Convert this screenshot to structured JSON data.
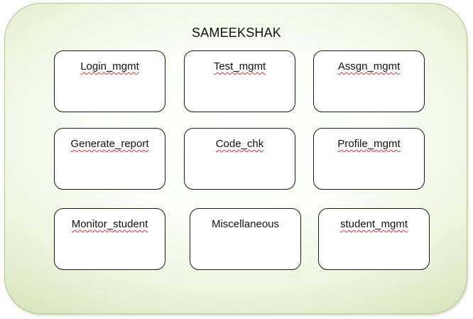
{
  "diagram": {
    "title": "SAMEEKSHAK",
    "modules": [
      {
        "label": "Login_mgmt"
      },
      {
        "label": "Test_mgmt"
      },
      {
        "label": "Assgn_mgmt"
      },
      {
        "label": "Generate_report"
      },
      {
        "label": "Code_chk"
      },
      {
        "label": "Profile_mgmt"
      },
      {
        "label": "Monitor_student"
      },
      {
        "label": "Miscellaneous"
      },
      {
        "label": "student_mgmt"
      }
    ]
  },
  "colors": {
    "container_border": "#b4c98e",
    "container_fill_edge": "#d9e6bf",
    "box_border": "#1a1a1a",
    "spellcheck_underline": "#d23a3a"
  }
}
